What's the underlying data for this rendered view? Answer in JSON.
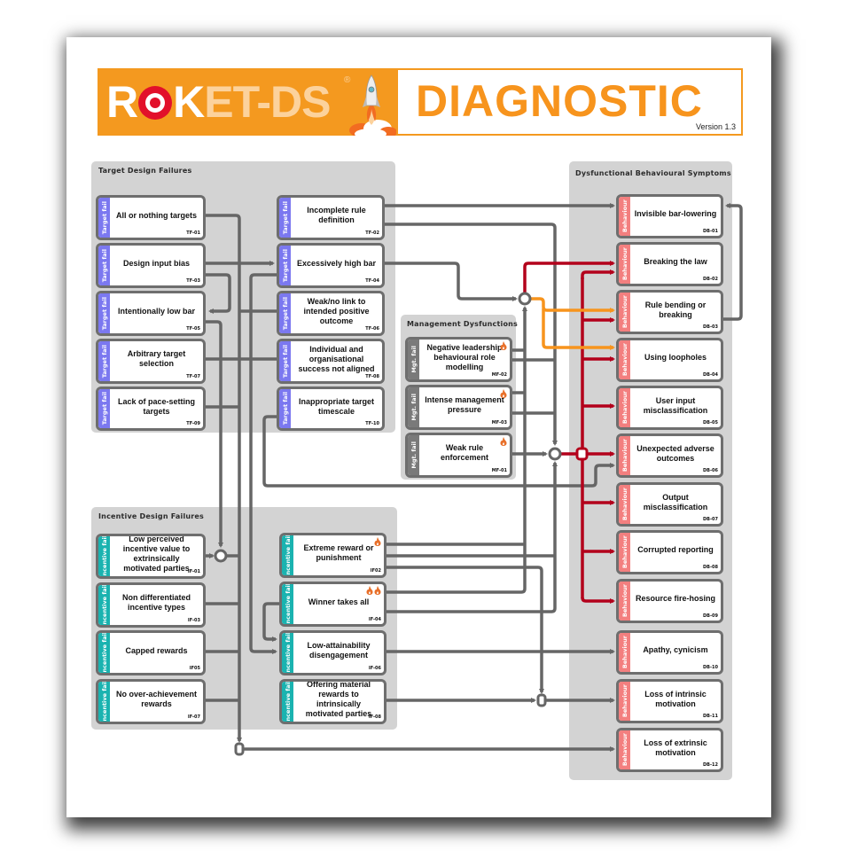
{
  "header": {
    "brand": "ROKET-DS",
    "brand_parts": [
      "R",
      "O",
      "K",
      "ET-DS"
    ],
    "registered": "®",
    "title": "DIAGNOSTIC",
    "version": "Version 1.3"
  },
  "colors": {
    "header_orange": "#f4991f",
    "title_orange": "#f7941d",
    "target_tag": "#7b78f0",
    "incentive_tag": "#1ab3b0",
    "management_tag": "#7a7a7a",
    "behaviour_tag": "#f37f7f",
    "connector_gray": "#666666",
    "connector_red": "#b3001b",
    "connector_orange": "#f7941d",
    "flame": "#e8702a"
  },
  "panels": {
    "target": {
      "title": "Target Design Failures",
      "tag": "Target fail",
      "items": [
        {
          "label": "All or nothing targets",
          "code": "TF-01"
        },
        {
          "label": "Incomplete rule definition",
          "code": "TF-02"
        },
        {
          "label": "Design input bias",
          "code": "TF-03"
        },
        {
          "label": "Excessively high bar",
          "code": "TF-04"
        },
        {
          "label": "Intentionally low bar",
          "code": "TF-05"
        },
        {
          "label": "Weak/no link to intended positive outcome",
          "code": "TF-06"
        },
        {
          "label": "Arbitrary target selection",
          "code": "TF-07"
        },
        {
          "label": "Individual and organisational success not aligned",
          "code": "TF-08"
        },
        {
          "label": "Lack of pace-setting targets",
          "code": "TF-09"
        },
        {
          "label": "Inappropriate target timescale",
          "code": "TF-10"
        }
      ]
    },
    "management": {
      "title": "Management Dysfunctions",
      "tag": "Mgt. fail",
      "items": [
        {
          "label": "Negative leadership behavioural role modelling",
          "code": "MF-02",
          "flames": 1
        },
        {
          "label": "Intense management pressure",
          "code": "MF-03",
          "flames": 1
        },
        {
          "label": "Weak rule enforcement",
          "code": "MF-01",
          "flames": 1
        }
      ]
    },
    "incentive": {
      "title": "Incentive Design Failures",
      "tag": "Incentive fail",
      "items": [
        {
          "label": "Low perceived incentive value to extrinsically motivated parties",
          "code": "IF-01"
        },
        {
          "label": "Extreme reward or punishment",
          "code": "IF02",
          "flames": 1
        },
        {
          "label": "Non differentiated incentive types",
          "code": "IF-03"
        },
        {
          "label": "Winner takes all",
          "code": "IF-04",
          "flames": 2
        },
        {
          "label": "Capped rewards",
          "code": "IF05"
        },
        {
          "label": "Low-attainability disengagement",
          "code": "IF-06"
        },
        {
          "label": "No over-achievement rewards",
          "code": "IF-07"
        },
        {
          "label": "Offering material rewards to intrinsically motivated parties",
          "code": "IF-08"
        }
      ]
    },
    "behaviour": {
      "title": "Dysfunctional Behavioural Symptoms",
      "tag": "Behaviour",
      "items": [
        {
          "label": "Invisible bar-lowering",
          "code": "DB-01"
        },
        {
          "label": "Breaking the law",
          "code": "DB-02"
        },
        {
          "label": "Rule bending or breaking",
          "code": "DB-03"
        },
        {
          "label": "Using loopholes",
          "code": "DB-04"
        },
        {
          "label": "User input misclassification",
          "code": "DB-05"
        },
        {
          "label": "Unexpected adverse outcomes",
          "code": "DB-06"
        },
        {
          "label": "Output misclassification",
          "code": "DB-07"
        },
        {
          "label": "Corrupted reporting",
          "code": "DB-08"
        },
        {
          "label": "Resource fire-hosing",
          "code": "DB-09"
        },
        {
          "label": "Apathy, cynicism",
          "code": "DB-10"
        },
        {
          "label": "Loss of intrinsic motivation",
          "code": "DB-11"
        },
        {
          "label": "Loss of extrinsic motivation",
          "code": "DB-12"
        }
      ]
    }
  }
}
